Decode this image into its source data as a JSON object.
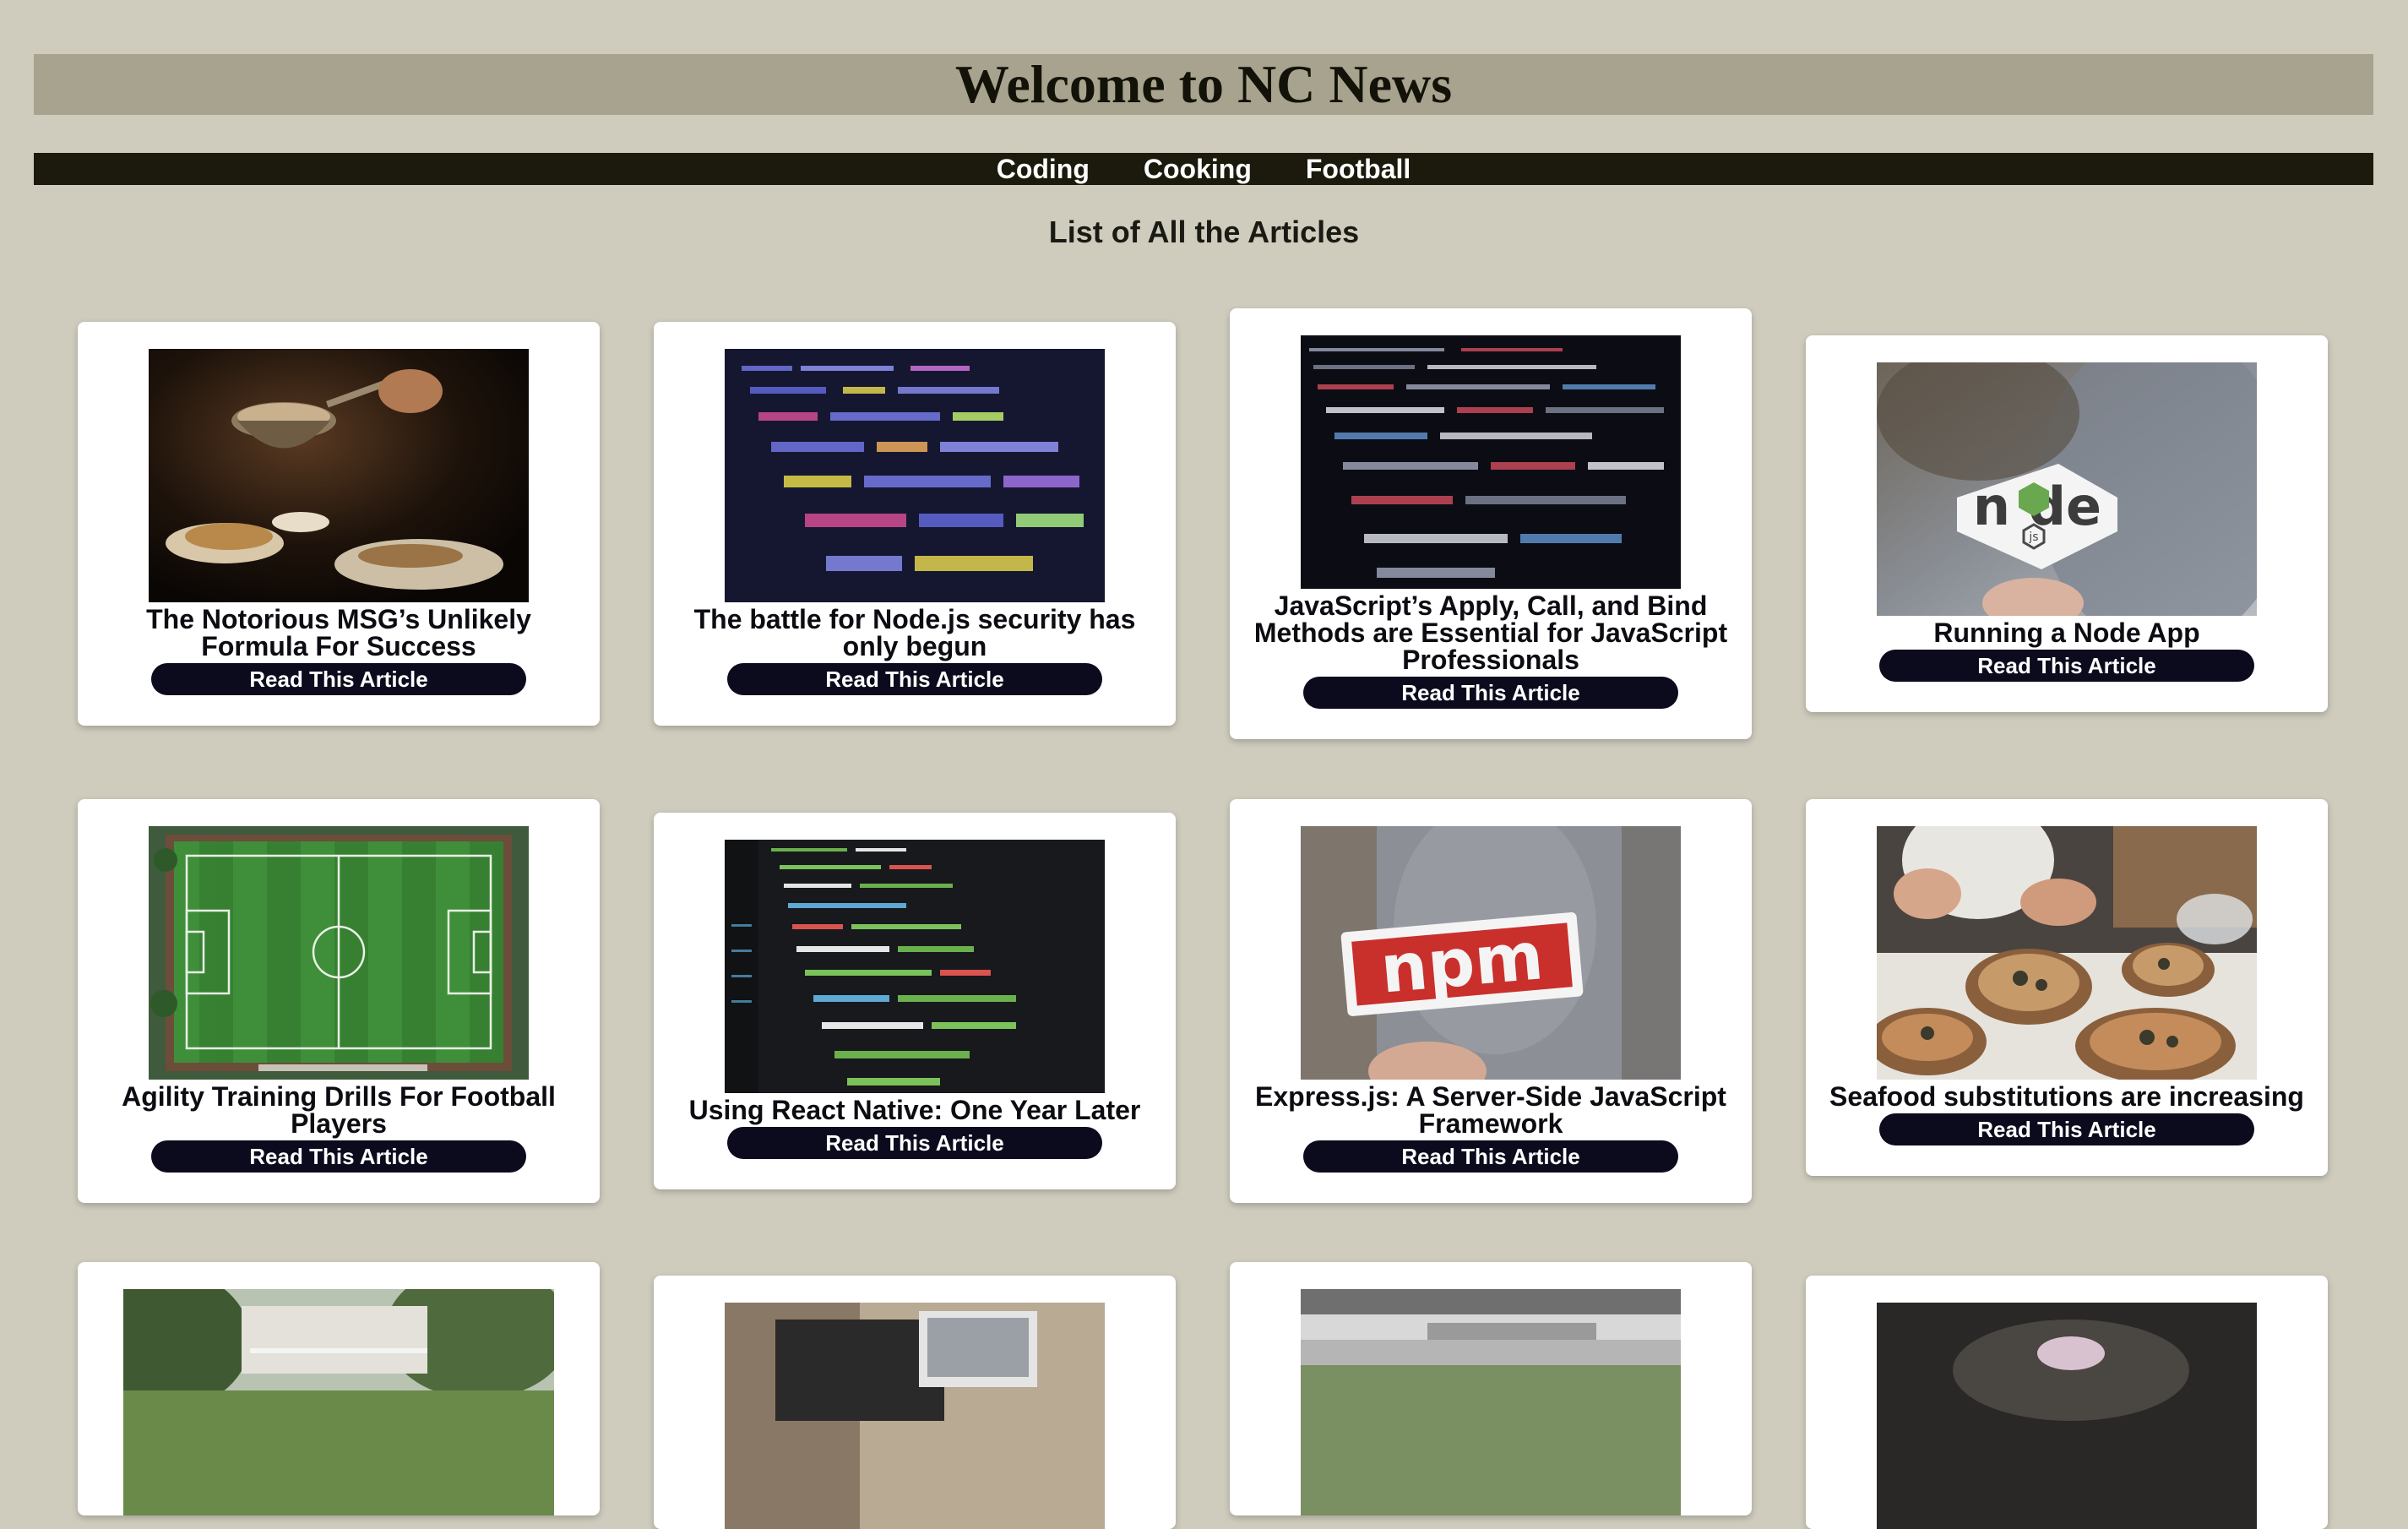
{
  "header": {
    "title": "Welcome to NC News"
  },
  "nav": {
    "items": [
      "Coding",
      "Cooking",
      "Football"
    ]
  },
  "page": {
    "subtitle": "List of All the Articles"
  },
  "articles": [
    {
      "title": "The Notorious MSG’s Unlikely Formula For Success",
      "button": "Read This Article",
      "image": "cooking-pan-photo"
    },
    {
      "title": "The battle for Node.js security has only begun",
      "button": "Read This Article",
      "image": "code-screen-photo"
    },
    {
      "title": "JavaScript’s Apply, Call, and Bind Methods are Essential for JavaScript Professionals",
      "button": "Read This Article",
      "image": "code-closeup-photo"
    },
    {
      "title": "Running a Node App",
      "button": "Read This Article",
      "image": "node-logo-sticker-photo"
    },
    {
      "title": "Agility Training Drills For Football Players",
      "button": "Read This Article",
      "image": "football-pitch-aerial-photo"
    },
    {
      "title": "Using React Native: One Year Later",
      "button": "Read This Article",
      "image": "code-editor-photo"
    },
    {
      "title": "Express.js: A Server-Side JavaScript Framework",
      "button": "Read This Article",
      "image": "npm-logo-sticker-photo"
    },
    {
      "title": "Seafood substitutions are increasing",
      "button": "Read This Article",
      "image": "chef-plating-photo"
    }
  ],
  "colors": {
    "page_background": "#cfccbd",
    "header_background": "#a8a38e",
    "nav_background": "#1c1a0c",
    "button_background": "#0c0b1e"
  }
}
